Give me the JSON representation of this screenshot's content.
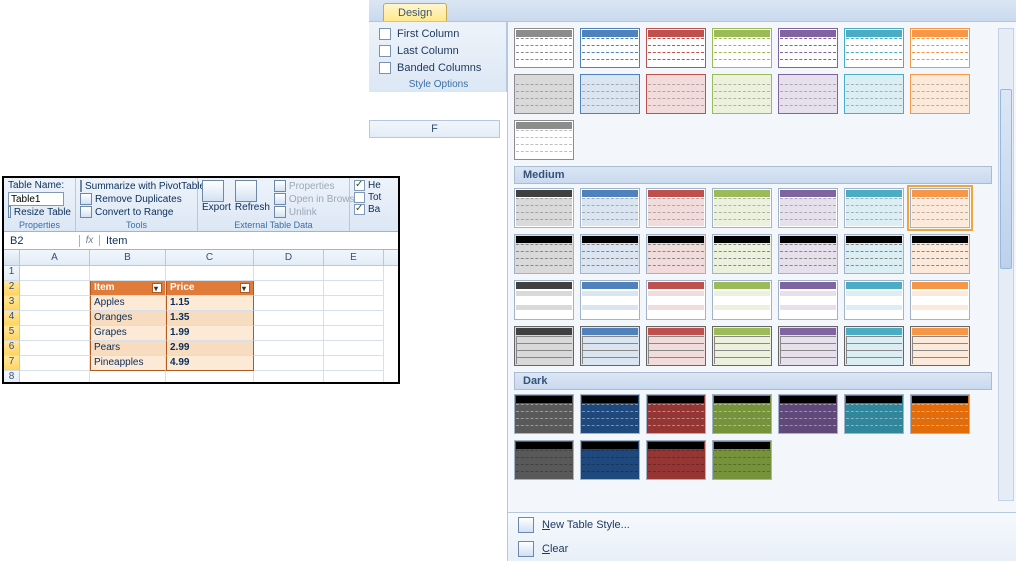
{
  "ribbon": {
    "active_tab": "Design",
    "options": {
      "first_column": "First Column",
      "last_column": "Last Column",
      "banded_columns": "Banded Columns",
      "group_label": "Style Options"
    },
    "column_header": "F",
    "sections": {
      "medium": "Medium",
      "dark": "Dark"
    },
    "footer": {
      "new_style": "New Table Style...",
      "clear": "Clear"
    }
  },
  "style_colors": {
    "light_borders": [
      "#8c8c8c",
      "#4f81bd",
      "#c0504d",
      "#9bbb59",
      "#8064a2",
      "#4bacc6",
      "#f79646"
    ],
    "medium_heads": [
      "#404040",
      "#4f81bd",
      "#c0504d",
      "#9bbb59",
      "#8064a2",
      "#4bacc6",
      "#f79646"
    ],
    "medium_fills": [
      "#d9d9d9",
      "#dbe5f1",
      "#f2dcdb",
      "#ebf1dd",
      "#e5e0ec",
      "#dbeef3",
      "#fde9d9"
    ],
    "dark_fills": [
      "#595959",
      "#1f497d",
      "#963634",
      "#76933c",
      "#60497a",
      "#31869b",
      "#e26b0a"
    ]
  },
  "inset": {
    "props": {
      "table_name_label": "Table Name:",
      "table_name_value": "Table1",
      "resize": "Resize Table",
      "group": "Properties"
    },
    "tools": {
      "pivot": "Summarize with PivotTable",
      "dupes": "Remove Duplicates",
      "range": "Convert to Range",
      "group": "Tools"
    },
    "ext": {
      "export": "Export",
      "refresh": "Refresh",
      "props": "Properties",
      "browser": "Open in Browser",
      "unlink": "Unlink",
      "group": "External Table Data"
    },
    "opts": {
      "he": "He",
      "tot": "Tot",
      "ba": "Ba"
    },
    "name_box": "B2",
    "fx_value": "Item",
    "columns": [
      "A",
      "B",
      "C",
      "D",
      "E"
    ],
    "rows": [
      "1",
      "2",
      "3",
      "4",
      "5",
      "6",
      "7",
      "8"
    ],
    "table": {
      "headers": [
        "Item",
        "Price"
      ],
      "data": [
        [
          "Apples",
          "1.15"
        ],
        [
          "Oranges",
          "1.35"
        ],
        [
          "Grapes",
          "1.99"
        ],
        [
          "Pears",
          "2.99"
        ],
        [
          "Pineapples",
          "4.99"
        ]
      ]
    }
  }
}
